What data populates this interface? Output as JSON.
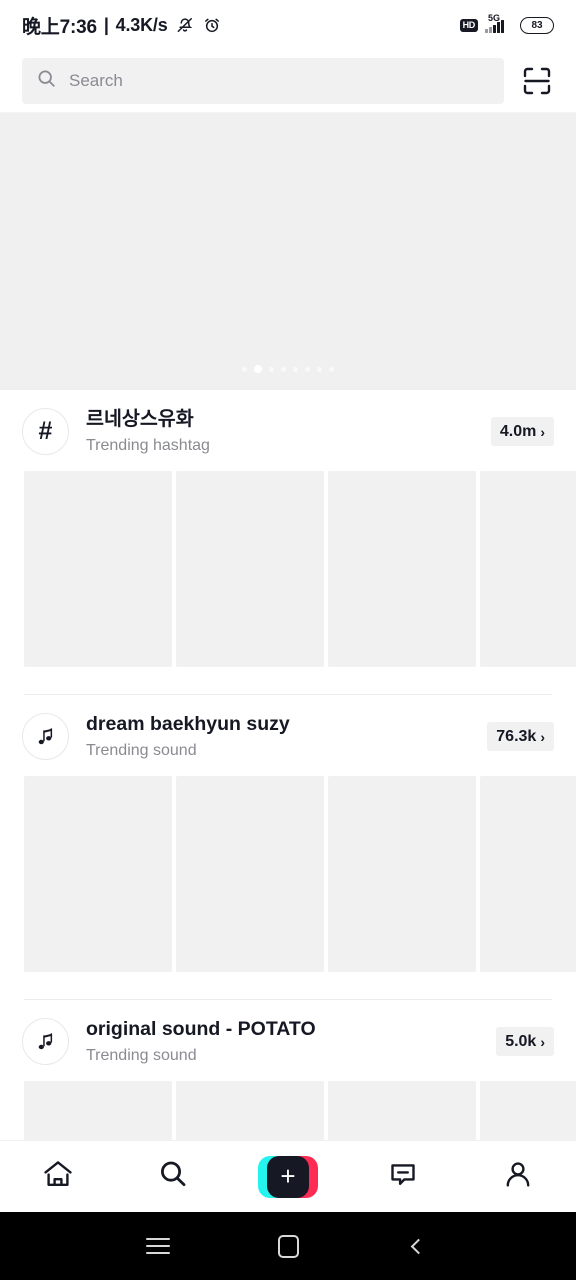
{
  "status_bar": {
    "time": "晚上7:36",
    "separator": "|",
    "network_speed": "4.3K/s",
    "mute_icon": "bell-off-icon",
    "alarm_icon": "alarm-clock-icon",
    "hd_badge": "HD",
    "network_type": "5G",
    "signal_icon": "signal-bars-icon",
    "battery_level": "83"
  },
  "search": {
    "icon": "search-icon",
    "placeholder": "Search",
    "value": "",
    "scan_icon": "scan-qr-icon"
  },
  "hero": {
    "dot_count": 8,
    "active_dot_index": 1
  },
  "sections": [
    {
      "avatar_icon": "hashtag-icon",
      "avatar_glyph": "#",
      "title": "르네상스유화",
      "subtitle": "Trending hashtag",
      "count": "4.0m",
      "chevron": "›",
      "thumb_count": 4
    },
    {
      "avatar_icon": "music-note-icon",
      "avatar_glyph": "♫",
      "title": "dream baekhyun suzy",
      "subtitle": "Trending sound",
      "count": "76.3k",
      "chevron": "›",
      "thumb_count": 4
    },
    {
      "avatar_icon": "music-note-icon",
      "avatar_glyph": "♫",
      "title": "original sound - POTATO",
      "subtitle": "Trending sound",
      "count": "5.0k",
      "chevron": "›",
      "thumb_count": 4
    }
  ],
  "tabbar": {
    "items": [
      {
        "icon": "home-icon",
        "label": "Home"
      },
      {
        "icon": "search-icon",
        "label": "Discover"
      },
      {
        "icon": "plus-icon",
        "label": "Create"
      },
      {
        "icon": "inbox-icon",
        "label": "Inbox"
      },
      {
        "icon": "profile-icon",
        "label": "Profile"
      }
    ],
    "create_plus": "+"
  },
  "android_nav": {
    "recents_icon": "recents-menu-icon",
    "home_icon": "home-square-icon",
    "back_icon": "back-chevron-icon"
  },
  "colors": {
    "accent_cyan": "#25f4ee",
    "accent_pink": "#fe2c55",
    "text_primary": "#161823",
    "text_secondary": "#8a8b91",
    "surface_gray": "#f1f1f2",
    "skeleton_gray": "#f1f1f1"
  }
}
